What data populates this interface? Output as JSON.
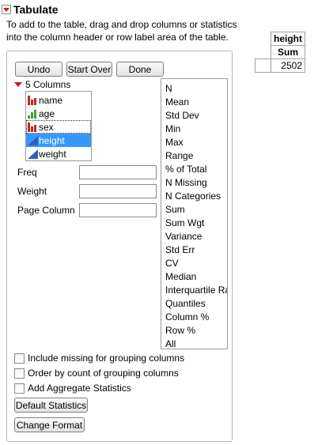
{
  "window": {
    "title": "Tabulate"
  },
  "instructions": "To add to the table, drag and drop columns or statistics into the column header or row label area of the table.",
  "result_table": {
    "header": "height",
    "subheader": "Sum",
    "value": "2502"
  },
  "buttons": {
    "undo": "Undo",
    "start_over": "Start Over",
    "done": "Done",
    "default_statistics": "Default Statistics",
    "change_format": "Change Format"
  },
  "columns": {
    "header": "5 Columns",
    "items": [
      {
        "label": "name",
        "icon": "nominal-icon"
      },
      {
        "label": "age",
        "icon": "ordinal-icon"
      },
      {
        "label": "sex",
        "icon": "nominal-icon"
      },
      {
        "label": "height",
        "icon": "continuous-icon",
        "selected": true
      },
      {
        "label": "weight",
        "icon": "continuous-icon"
      }
    ]
  },
  "fields": {
    "freq": "Freq",
    "weight": "Weight",
    "page_column": "Page Column"
  },
  "statistics": [
    "N",
    "Mean",
    "Std Dev",
    "Min",
    "Max",
    "Range",
    "% of Total",
    "N Missing",
    "N Categories",
    "Sum",
    "Sum Wgt",
    "Variance",
    "Std Err",
    "CV",
    "Median",
    "Interquartile Range",
    "Quantiles",
    "Column %",
    "Row %",
    "All"
  ],
  "options": {
    "include_missing": "Include missing for grouping columns",
    "order_by_count": "Order by count of grouping columns",
    "aggregate": "Add Aggregate Statistics"
  },
  "colors": {
    "selection": "#3399ff",
    "disclosure": "#d01818",
    "nominal": "#c0281c",
    "ordinal": "#3aa13a",
    "continuous": "#3060c0"
  }
}
